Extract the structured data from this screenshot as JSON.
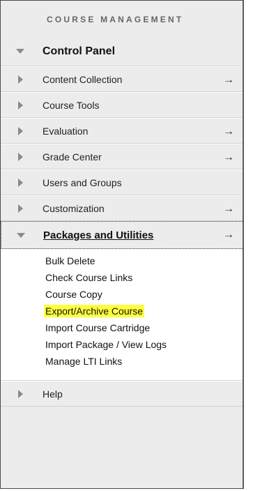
{
  "title": "COURSE MANAGEMENT",
  "control_panel": "Control Panel",
  "items": [
    {
      "label": "Content Collection",
      "arrow": "→"
    },
    {
      "label": "Course Tools",
      "arrow": ""
    },
    {
      "label": "Evaluation",
      "arrow": "→"
    },
    {
      "label": "Grade Center",
      "arrow": "→"
    },
    {
      "label": "Users and Groups",
      "arrow": ""
    },
    {
      "label": "Customization",
      "arrow": "→"
    }
  ],
  "packages": {
    "label": "Packages and Utilities",
    "arrow": "→",
    "subitems": [
      "Bulk Delete",
      "Check Course Links",
      "Course Copy",
      "Export/Archive Course",
      "Import Course Cartridge",
      "Import Package / View Logs",
      "Manage LTI Links"
    ]
  },
  "help": "Help",
  "highlight_color": "#ffff40"
}
